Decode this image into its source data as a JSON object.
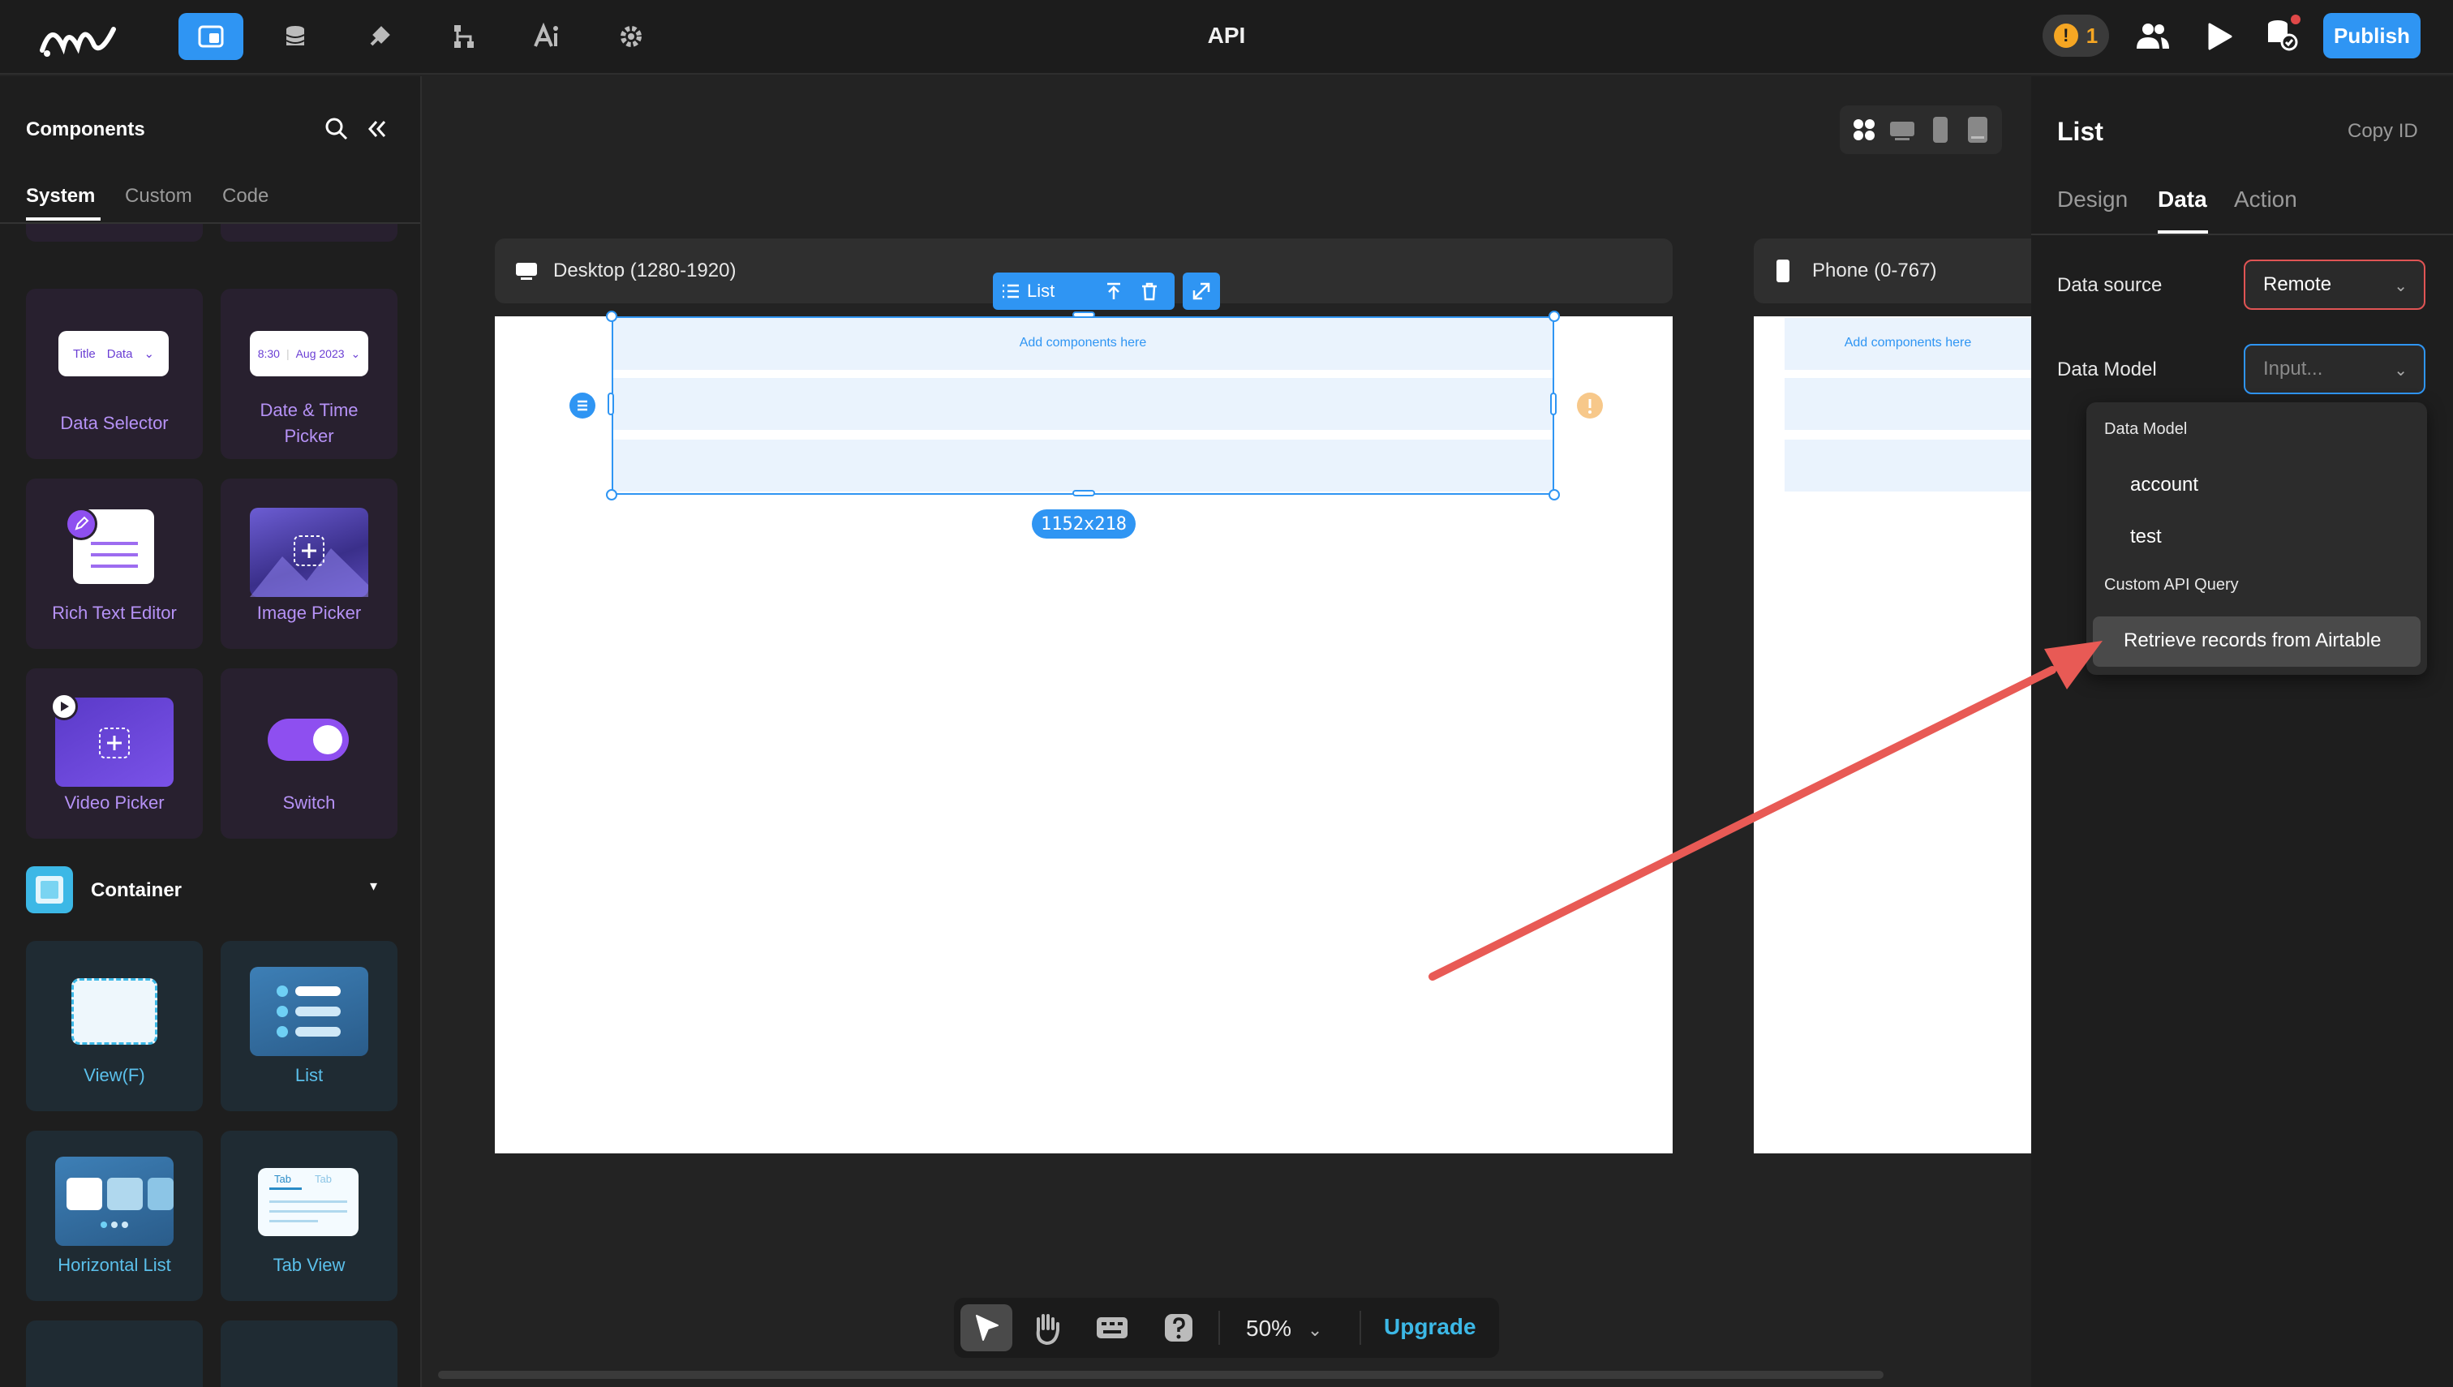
{
  "app": {
    "title": "API"
  },
  "topbar": {
    "warning_count": "1",
    "publish_label": "Publish",
    "nav_icons": [
      "pages-icon",
      "database-icon",
      "plugin-icon",
      "workflow-icon",
      "ai-icon",
      "settings-icon"
    ]
  },
  "left_panel": {
    "title": "Components",
    "tabs": [
      "System",
      "Custom",
      "Code"
    ],
    "items": [
      {
        "label": "Data Selector",
        "thumb_title": "Title",
        "thumb_data": "Data"
      },
      {
        "label": "Date & Time Picker",
        "thumb_time": "8:30",
        "thumb_date": "Aug 2023"
      },
      {
        "label": "Rich Text Editor"
      },
      {
        "label": "Image Picker"
      },
      {
        "label": "Video Picker"
      },
      {
        "label": "Switch"
      }
    ],
    "container_section": "Container",
    "container_items": [
      {
        "label": "View(F)"
      },
      {
        "label": "List"
      },
      {
        "label": "Horizontal List"
      },
      {
        "label": "Tab View",
        "thumb_tab1": "Tab",
        "thumb_tab2": "Tab"
      }
    ]
  },
  "canvas": {
    "desktop_label": "Desktop (1280-1920)",
    "phone_label": "Phone (0-767)",
    "list_toolbar_label": "List",
    "add_components": "Add components here",
    "size_label": "1152x218",
    "zoom": "50%",
    "upgrade_label": "Upgrade"
  },
  "right_panel": {
    "title": "List",
    "copy_id": "Copy ID",
    "tabs": [
      "Design",
      "Data",
      "Action"
    ],
    "data_source_label": "Data source",
    "data_source_value": "Remote",
    "data_model_label": "Data Model",
    "data_model_placeholder": "Input...",
    "dropdown": {
      "section1": "Data Model",
      "models": [
        "account",
        "test"
      ],
      "section2": "Custom API Query",
      "queries": [
        "Retrieve records from Airtable"
      ]
    }
  },
  "colors": {
    "accent": "#2f95f3",
    "warning": "#f5a623",
    "annotation_arrow": "#e85a55"
  }
}
